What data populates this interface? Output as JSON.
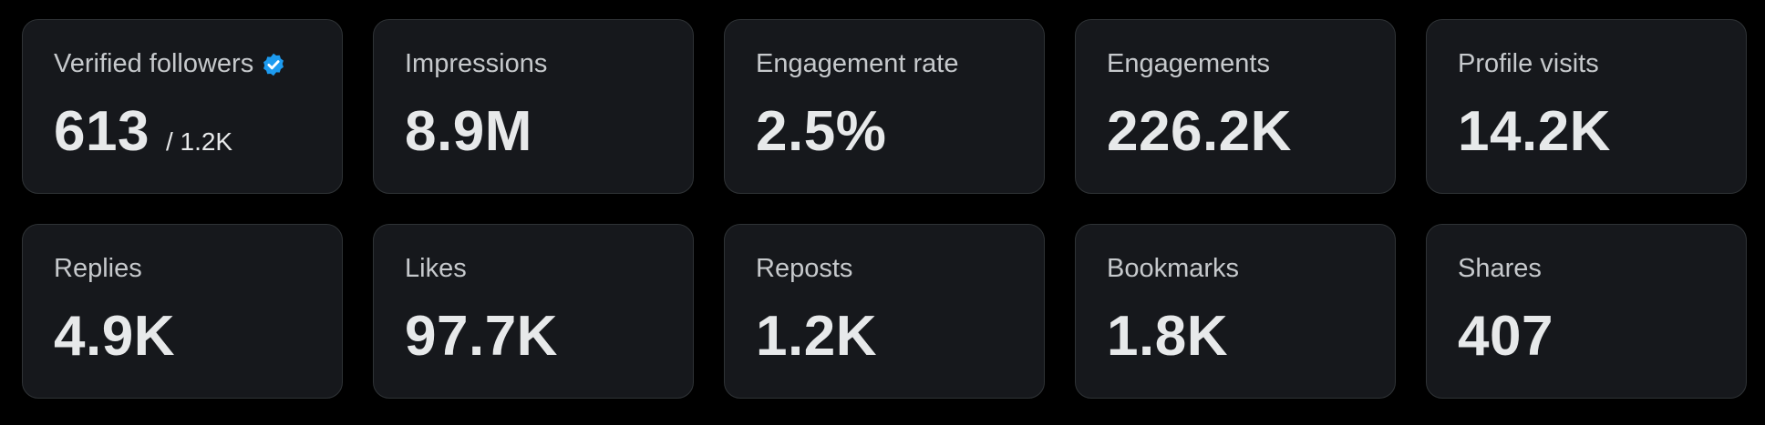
{
  "accent_color": "#1d9bf0",
  "stats": [
    {
      "label": "Verified followers",
      "value": "613",
      "sub_value": "/ 1.2K",
      "icon": "verified-badge-icon"
    },
    {
      "label": "Impressions",
      "value": "8.9M"
    },
    {
      "label": "Engagement rate",
      "value": "2.5%"
    },
    {
      "label": "Engagements",
      "value": "226.2K"
    },
    {
      "label": "Profile visits",
      "value": "14.2K"
    },
    {
      "label": "Replies",
      "value": "4.9K"
    },
    {
      "label": "Likes",
      "value": "97.7K"
    },
    {
      "label": "Reposts",
      "value": "1.2K"
    },
    {
      "label": "Bookmarks",
      "value": "1.8K"
    },
    {
      "label": "Shares",
      "value": "407"
    }
  ]
}
